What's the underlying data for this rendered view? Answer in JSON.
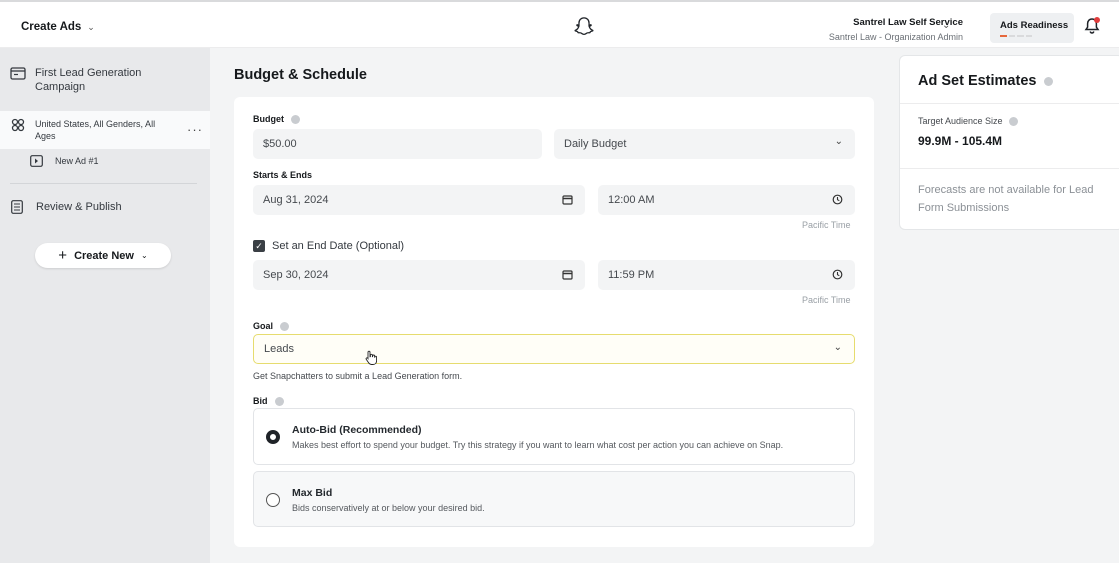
{
  "header": {
    "app_menu_label": "Create Ads",
    "org_name": "Santrel Law Self Service",
    "org_role": "Santrel Law - Organization Admin",
    "readiness_label": "Ads Readiness"
  },
  "sidebar": {
    "campaign": "First Lead Generation Campaign",
    "adset": "United States, All Genders, All Ages",
    "ad": "New Ad #1",
    "review": "Review & Publish",
    "create_new": "Create New"
  },
  "main": {
    "section_title": "Budget & Schedule",
    "budget_label": "Budget",
    "budget_value": "$50.00",
    "budget_type": "Daily Budget",
    "starts_label": "Starts & Ends",
    "start_date": "Aug 31, 2024",
    "start_time": "12:00 AM",
    "timezone": "Pacific Time",
    "end_date_checkbox": "Set an End Date (Optional)",
    "end_date": "Sep 30, 2024",
    "end_time": "11:59 PM",
    "goal_label": "Goal",
    "goal_value": "Leads",
    "goal_helper": "Get Snapchatters to submit a Lead Generation form.",
    "bid_label": "Bid",
    "bid_options": [
      {
        "title": "Auto-Bid (Recommended)",
        "desc": "Makes best effort to spend your budget. Try this strategy if you want to learn what cost per action you can achieve on Snap.",
        "selected": true
      },
      {
        "title": "Max Bid",
        "desc": "Bids conservatively at or below your desired bid.",
        "selected": false
      }
    ]
  },
  "estimates": {
    "title": "Ad Set Estimates",
    "audience_label": "Target Audience Size",
    "audience_value": "99.9M - 105.4M",
    "note": "Forecasts are not available for Lead Form Submissions"
  },
  "colors": {
    "notification_dot": "#e03c3c",
    "readiness_progress": "#e6683c",
    "goal_highlight_border": "#e6dc6e"
  }
}
